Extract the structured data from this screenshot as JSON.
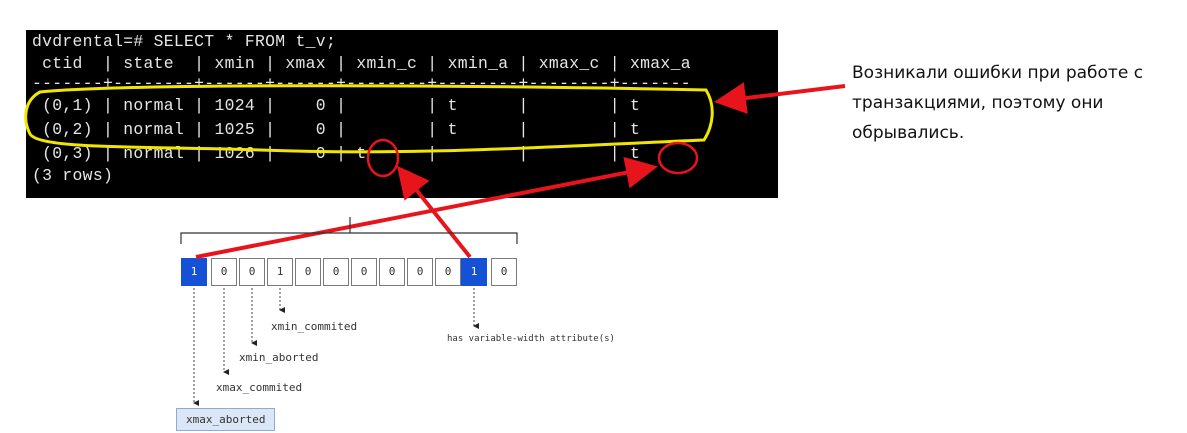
{
  "terminal": {
    "lines": [
      "dvdrental=# SELECT * FROM t_v;",
      " ctid  | state  | xmin | xmax | xmin_c | xmin_a | xmax_c | xmax_a",
      "-------+--------+------+------+--------+--------+--------+-------",
      " (0,1) | normal | 1024 |    0 |        | t      |        | t",
      " (0,2) | normal | 1025 |    0 |        | t      |        | t",
      " (0,3) | normal | 1026 |    0 | t      |        |        | t",
      "(3 rows)"
    ]
  },
  "annotation": {
    "lines": [
      "Возникали ошибки при работе с",
      "транзакциями, поэтому они",
      "обрывались."
    ]
  },
  "bitfield": {
    "bits": [
      "1",
      "0",
      "0",
      "1",
      "0",
      "0",
      "0",
      "0",
      "0",
      "0",
      "1",
      "0"
    ],
    "highlighted": [
      0,
      10
    ],
    "labels": {
      "xmin_commited": "xmin_commited",
      "xmin_aborted": "xmin_aborted",
      "xmax_commited": "xmax_commited",
      "xmax_aborted": "xmax_aborted",
      "varwidth": "has variable-width attribute(s)"
    }
  },
  "colors": {
    "terminal_bg": "#000000",
    "terminal_text": "#e6e6e6",
    "highlight_yellow": "#f2e600",
    "arrow_red": "#e8141c",
    "bit_highlight": "#1451d6",
    "label_box": "#dbe7f7"
  }
}
